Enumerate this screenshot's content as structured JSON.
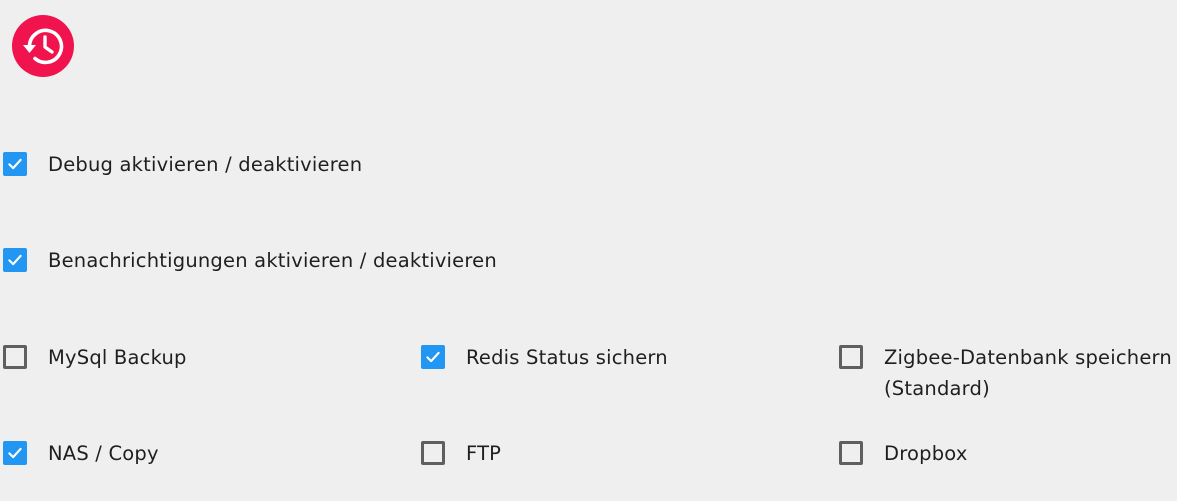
{
  "header": {
    "logo_icon": "backup-restore-icon",
    "logo_color": "#f0134d"
  },
  "settings": {
    "debug": {
      "label": "Debug aktivieren / deaktivieren",
      "checked": true
    },
    "notifications": {
      "label": "Benachrichtigungen aktivieren / deaktivieren",
      "checked": true
    }
  },
  "backup_options": [
    {
      "label": "MySql Backup",
      "checked": false
    },
    {
      "label": "Redis Status sichern",
      "checked": true
    },
    {
      "label": "Zigbee-Datenbank speichern\n(Standard)",
      "checked": false
    },
    {
      "label": "NAS / Copy",
      "checked": true
    },
    {
      "label": "FTP",
      "checked": false
    },
    {
      "label": "Dropbox",
      "checked": false
    }
  ],
  "colors": {
    "checkbox_checked": "#2196f3",
    "checkbox_unchecked_border": "#5f5f5f",
    "background": "#efefef"
  }
}
